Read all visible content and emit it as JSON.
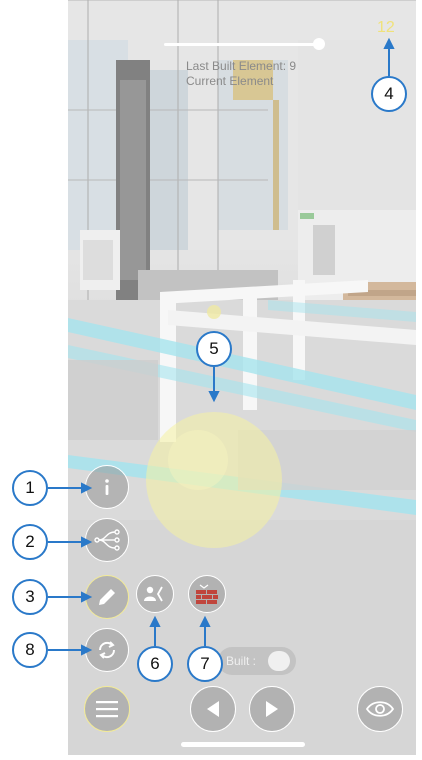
{
  "status": {
    "line1": "Last Built Element: 9",
    "line2": "Current Element"
  },
  "counter": "12",
  "toggle": {
    "label": "Built :"
  },
  "callouts": [
    "1",
    "2",
    "3",
    "4",
    "5",
    "6",
    "7",
    "8"
  ],
  "colors": {
    "callout_border": "#2a79c9",
    "counter": "#f0e27a",
    "active_border": "#f3eb96",
    "beam": "#7fd8e6",
    "sphere": "#f2ec7a"
  },
  "icons": {
    "info": "info-icon",
    "paths": "paths-icon",
    "edit": "pencil-icon",
    "sync": "sync-icon",
    "menu": "menu-icon",
    "prev": "play-left-icon",
    "next": "play-right-icon",
    "view": "eye-icon",
    "user_swap": "user-swap-icon",
    "brick_wall": "brick-wall-icon"
  }
}
